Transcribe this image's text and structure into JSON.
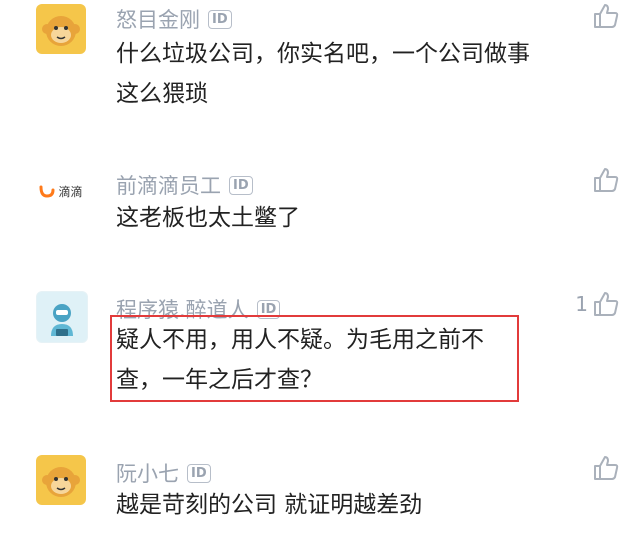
{
  "comments": [
    {
      "user": "怒目金刚",
      "badge": "ID",
      "text": "什么垃圾公司，你实名吧，一个公司做事这么猥琐",
      "likes": ""
    },
    {
      "user": "前滴滴员工",
      "badge": "ID",
      "avatar_text": "滴滴",
      "text": "这老板也太土鳖了",
      "likes": ""
    },
    {
      "user": "程序猿.醉道人",
      "badge": "ID",
      "text": "疑人不用，用人不疑。为毛用之前不查，一年之后才查？",
      "likes": "1"
    },
    {
      "user": "阮小七",
      "badge": "ID",
      "text": "越是苛刻的公司 就证明越差劲",
      "likes": ""
    }
  ],
  "colors": {
    "highlight": "#e23b3b",
    "meta": "#9aa3b0",
    "monkey": "#f5c64a",
    "didi_orange": "#ff7a1a"
  },
  "icons": {
    "like": "thumb-up-icon"
  }
}
